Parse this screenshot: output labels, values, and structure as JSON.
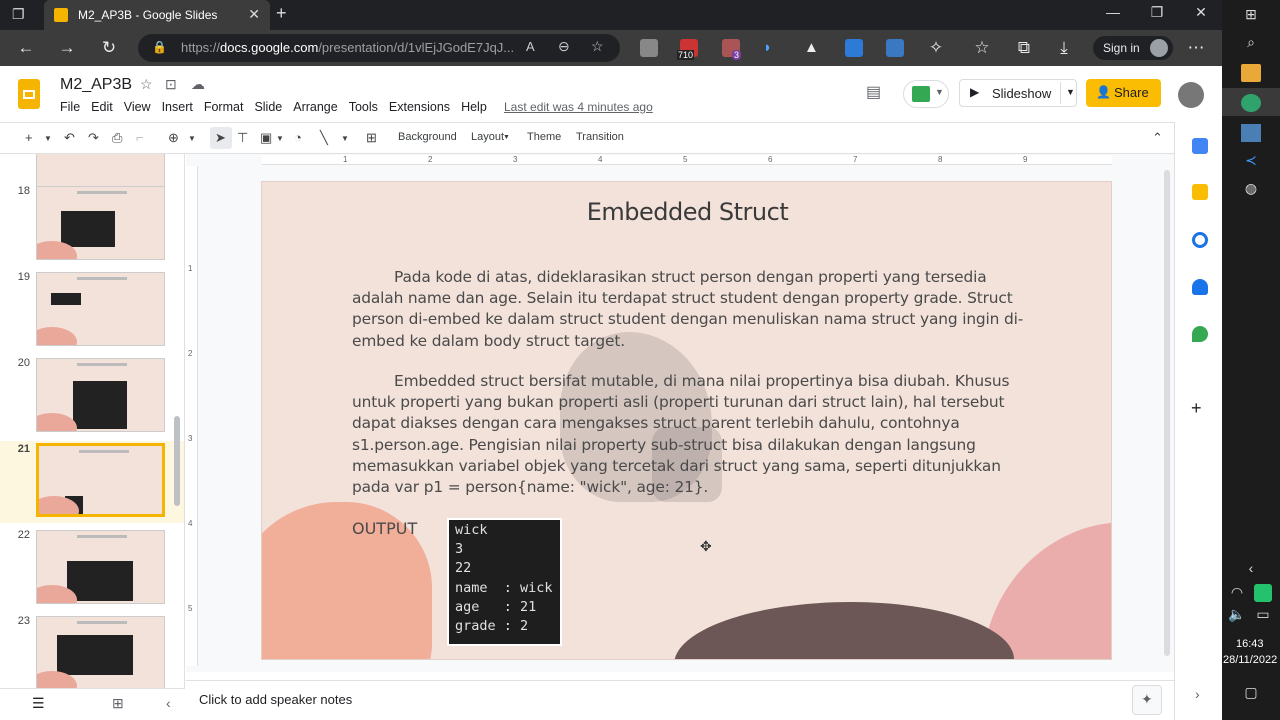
{
  "browser": {
    "tab_title": "M2_AP3B - Google Slides",
    "url_prefix": "https://",
    "url_domain": "docs.google.com",
    "url_path": "/presentation/d/1vlEjJGodE7JqJ...",
    "signin_label": "Sign in",
    "badge_710": "710",
    "badge_3": "3"
  },
  "app": {
    "doc_name": "M2_AP3B",
    "menus": [
      "File",
      "Edit",
      "View",
      "Insert",
      "Format",
      "Slide",
      "Arrange",
      "Tools",
      "Extensions",
      "Help"
    ],
    "last_edit": "Last edit was 4 minutes ago",
    "slideshow_label": "Slideshow",
    "share_label": "Share"
  },
  "toolbar": {
    "background_label": "Background",
    "layout_label": "Layout",
    "theme_label": "Theme",
    "transition_label": "Transition"
  },
  "ruler": {
    "h_ticks": [
      "1",
      "2",
      "3",
      "4",
      "5",
      "6",
      "7",
      "8",
      "9"
    ],
    "v_ticks": [
      "1",
      "2",
      "3",
      "4",
      "5"
    ]
  },
  "filmstrip": {
    "slides": [
      {
        "num": "18",
        "selected": false
      },
      {
        "num": "19",
        "selected": false
      },
      {
        "num": "20",
        "selected": false
      },
      {
        "num": "21",
        "selected": true
      },
      {
        "num": "22",
        "selected": false
      },
      {
        "num": "23",
        "selected": false
      }
    ]
  },
  "slide": {
    "title": "Embedded Struct",
    "para1": "Pada kode di atas, dideklarasikan struct person dengan properti yang tersedia adalah name dan age. Selain itu terdapat struct student dengan property grade. Struct person di-embed ke dalam struct student dengan menuliskan nama struct yang ingin di-embed ke dalam body struct target.",
    "para2": "Embedded struct bersifat mutable, di mana nilai propertinya bisa diubah. Khusus untuk properti yang bukan properti asli (properti turunan dari struct lain), hal tersebut dapat diakses dengan cara mengakses struct parent terlebih dahulu, contohnya s1.person.age. Pengisian nilai property sub-struct bisa dilakukan dengan langsung memasukkan variabel objek yang tercetak dari struct yang sama, seperti ditunjukkan pada var p1 = person{name: \"wick\", age: 21}.",
    "output_label": "OUTPUT",
    "code_output": "wick\n3\n22\nname  : wick\nage   : 21\ngrade : 2"
  },
  "notes": {
    "placeholder": "Click to add speaker notes"
  },
  "taskbar": {
    "time": "16:43",
    "date": "28/11/2022"
  },
  "colors": {
    "slide_bg": "#f3e2da",
    "share_yellow": "#fbbc04",
    "selected_border": "#f4b400"
  }
}
